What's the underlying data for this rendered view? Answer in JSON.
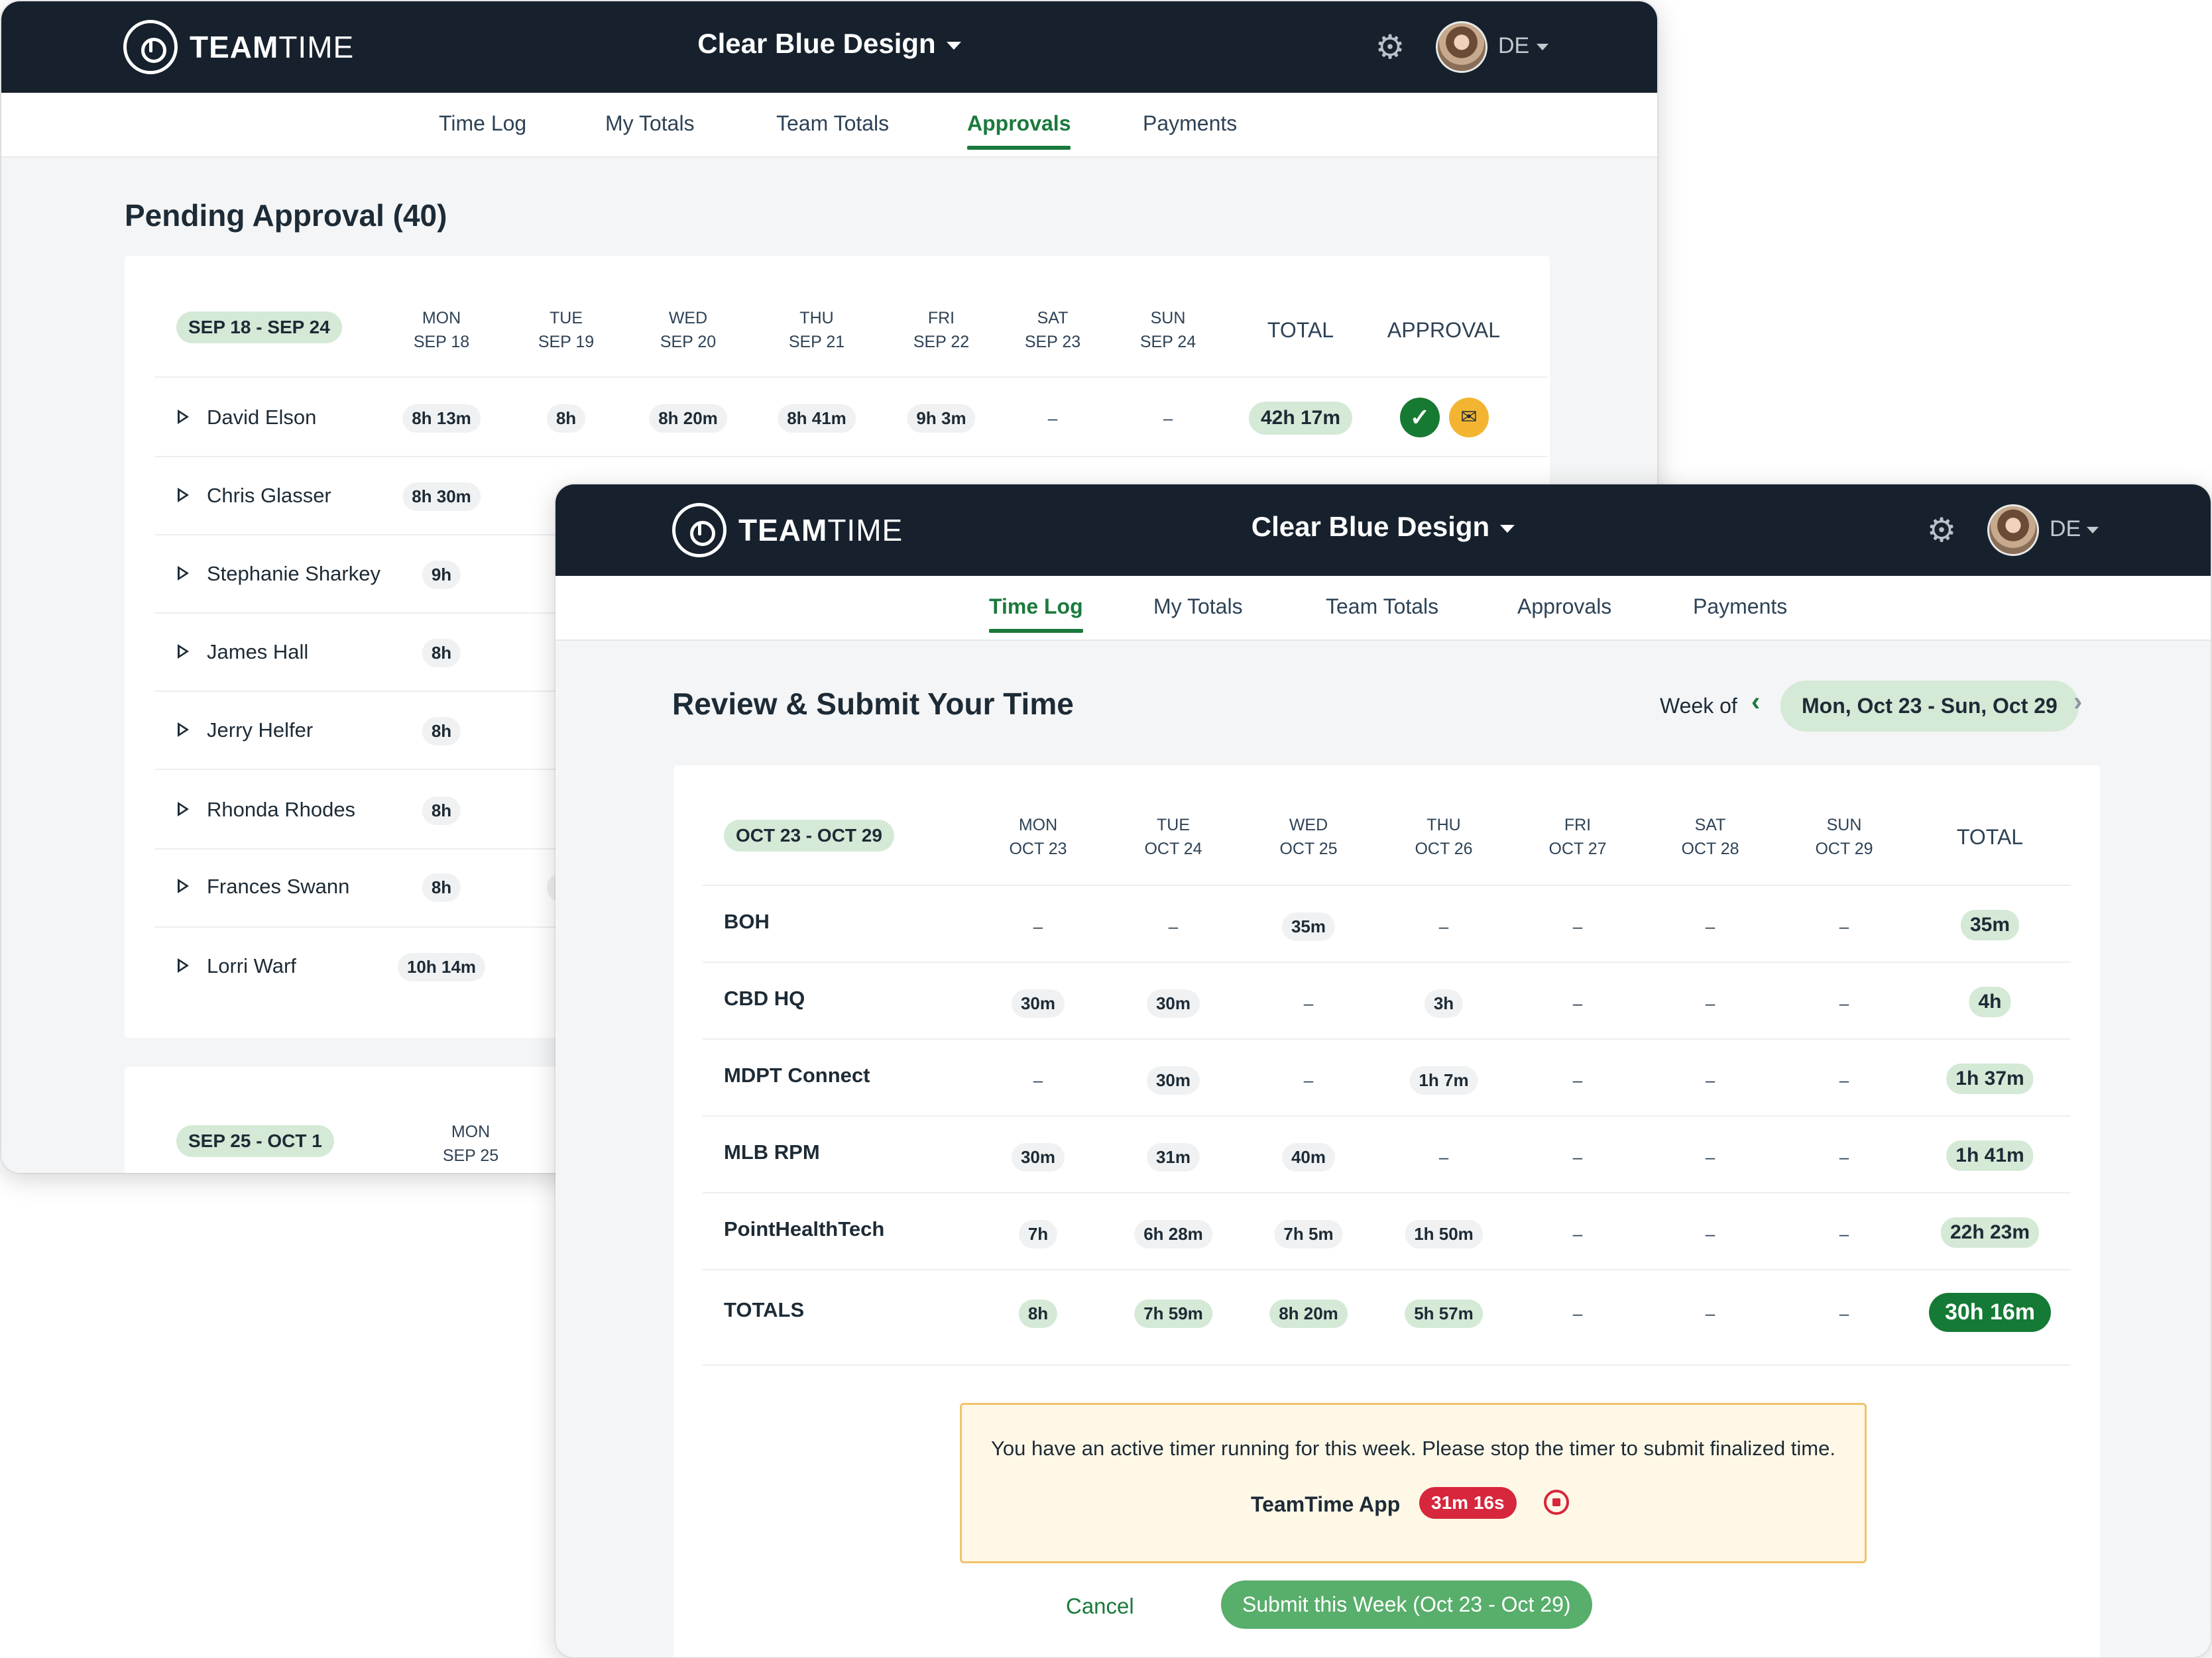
{
  "brand": {
    "name_bold": "TEAM",
    "name_light": "TIME"
  },
  "org_name": "Clear Blue Design",
  "user": {
    "initials": "DE"
  },
  "nav": {
    "tabs": [
      "Time Log",
      "My Totals",
      "Team Totals",
      "Approvals",
      "Payments"
    ]
  },
  "back": {
    "active_tab": "Approvals",
    "title": "Pending Approval (40)",
    "range": "SEP 18 - SEP 24",
    "days": [
      {
        "dow": "MON",
        "date": "SEP 18"
      },
      {
        "dow": "TUE",
        "date": "SEP 19"
      },
      {
        "dow": "WED",
        "date": "SEP 20"
      },
      {
        "dow": "THU",
        "date": "SEP 21"
      },
      {
        "dow": "FRI",
        "date": "SEP 22"
      },
      {
        "dow": "SAT",
        "date": "SEP 23"
      },
      {
        "dow": "SUN",
        "date": "SEP 24"
      }
    ],
    "total_label": "TOTAL",
    "approval_label": "APPROVAL",
    "rows": [
      {
        "name": "David Elson",
        "cells": [
          "8h 13m",
          "8h",
          "8h 20m",
          "8h 41m",
          "9h 3m",
          "–",
          "–"
        ],
        "total": "42h 17m"
      },
      {
        "name": "Chris Glasser",
        "cells": [
          "8h 30m"
        ]
      },
      {
        "name": "Stephanie Sharkey",
        "cells": [
          "9h"
        ]
      },
      {
        "name": "James Hall",
        "cells": [
          "8h"
        ]
      },
      {
        "name": "Jerry Helfer",
        "cells": [
          "8h"
        ]
      },
      {
        "name": "Rhonda Rhodes",
        "cells": [
          "8h"
        ]
      },
      {
        "name": "Frances Swann",
        "cells": [
          "8h",
          "8h"
        ]
      },
      {
        "name": "Lorri Warf",
        "cells": [
          "10h 14m"
        ]
      }
    ],
    "next_range": "SEP 25 - OCT 1",
    "next_day": {
      "dow": "MON",
      "date": "SEP 25"
    }
  },
  "front": {
    "active_tab": "Time Log",
    "title": "Review & Submit Your Time",
    "week_of_label": "Week of",
    "week_range": "Mon, Oct 23 - Sun, Oct 29",
    "range": "OCT 23 - OCT 29",
    "days": [
      {
        "dow": "MON",
        "date": "OCT 23"
      },
      {
        "dow": "TUE",
        "date": "OCT 24"
      },
      {
        "dow": "WED",
        "date": "OCT 25"
      },
      {
        "dow": "THU",
        "date": "OCT 26"
      },
      {
        "dow": "FRI",
        "date": "OCT 27"
      },
      {
        "dow": "SAT",
        "date": "OCT 28"
      },
      {
        "dow": "SUN",
        "date": "OCT 29"
      }
    ],
    "total_label": "TOTAL",
    "rows": [
      {
        "name": "BOH",
        "cells": [
          "–",
          "–",
          "35m",
          "–",
          "–",
          "–",
          "–"
        ],
        "total": "35m"
      },
      {
        "name": "CBD HQ",
        "cells": [
          "30m",
          "30m",
          "–",
          "3h",
          "–",
          "–",
          "–"
        ],
        "total": "4h"
      },
      {
        "name": "MDPT Connect",
        "cells": [
          "–",
          "30m",
          "–",
          "1h 7m",
          "–",
          "–",
          "–"
        ],
        "total": "1h 37m"
      },
      {
        "name": "MLB RPM",
        "cells": [
          "30m",
          "31m",
          "40m",
          "–",
          "–",
          "–",
          "–"
        ],
        "total": "1h 41m"
      },
      {
        "name": "PointHealthTech",
        "cells": [
          "7h",
          "6h 28m",
          "7h 5m",
          "1h 50m",
          "–",
          "–",
          "–"
        ],
        "total": "22h 23m"
      }
    ],
    "totals_row": {
      "name": "TOTALS",
      "cells": [
        "8h",
        "7h 59m",
        "8h 20m",
        "5h 57m",
        "–",
        "–",
        "–"
      ],
      "total": "30h 16m"
    },
    "alert": {
      "message": "You have an active timer running for this week. Please stop the timer to submit finalized time.",
      "app_name": "TeamTime App",
      "timer": "31m 16s"
    },
    "cancel_label": "Cancel",
    "submit_label": "Submit this Week (Oct 23 - Oct 29)"
  },
  "colors": {
    "navy": "#16212d",
    "accent_green": "#1a7a3c",
    "pill_green": "#d4e9d6",
    "warning": "#f3b531",
    "danger": "#d6273c"
  },
  "icons": [
    "teamtime-logo-icon",
    "gear-icon",
    "user-avatar",
    "chevron-down-icon",
    "expand-triangle-icon",
    "check-icon",
    "envelope-icon",
    "chevron-left-icon",
    "chevron-right-icon",
    "stop-timer-icon"
  ]
}
